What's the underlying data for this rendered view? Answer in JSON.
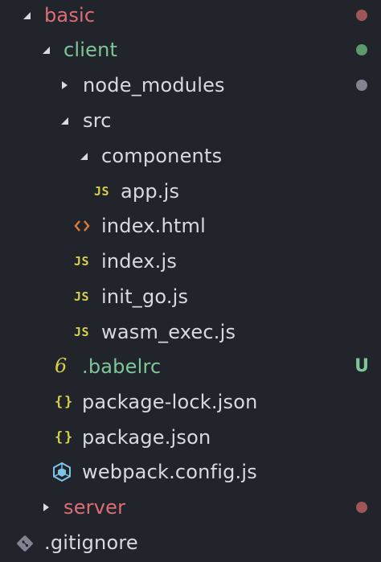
{
  "colors": {
    "background": "#21252b",
    "twisty": "#d7dae0",
    "text_default": "#d7dae0",
    "text_modified": "#e06c75",
    "text_untracked": "#7ec699",
    "dot_modified": "#a05559",
    "dot_untracked": "#5d9a6a",
    "dot_ignored": "#7f848e",
    "js_icon": "#d6cf4b",
    "json_icon": "#d6cf4b",
    "html_icon": "#e07b39",
    "babel_icon": "#d6cf4b",
    "webpack_icon": "#7ec3e6",
    "git_icon": "#7f848e"
  },
  "tree": [
    {
      "name": "basic",
      "kind": "folder",
      "expanded": true,
      "status": "modified",
      "badge": "dot"
    },
    {
      "name": "client",
      "kind": "folder",
      "expanded": true,
      "status": "untracked",
      "badge": "dot"
    },
    {
      "name": "node_modules",
      "kind": "folder",
      "expanded": false,
      "status": "ignored",
      "badge": "dot"
    },
    {
      "name": "src",
      "kind": "folder",
      "expanded": true,
      "status": "default",
      "badge": ""
    },
    {
      "name": "components",
      "kind": "folder",
      "expanded": true,
      "status": "default",
      "badge": ""
    },
    {
      "name": "app.js",
      "kind": "file",
      "icon": "javascript-icon",
      "icon_text": "JS",
      "status": "default",
      "badge": ""
    },
    {
      "name": "index.html",
      "kind": "file",
      "icon": "html-icon",
      "icon_text": "<>",
      "status": "default",
      "badge": ""
    },
    {
      "name": "index.js",
      "kind": "file",
      "icon": "javascript-icon",
      "icon_text": "JS",
      "status": "default",
      "badge": ""
    },
    {
      "name": "init_go.js",
      "kind": "file",
      "icon": "javascript-icon",
      "icon_text": "JS",
      "status": "default",
      "badge": ""
    },
    {
      "name": "wasm_exec.js",
      "kind": "file",
      "icon": "javascript-icon",
      "icon_text": "JS",
      "status": "default",
      "badge": ""
    },
    {
      "name": ".babelrc",
      "kind": "file",
      "icon": "babel-icon",
      "icon_text": "6",
      "status": "untracked",
      "badge": "U"
    },
    {
      "name": "package-lock.json",
      "kind": "file",
      "icon": "json-icon",
      "icon_text": "{}",
      "status": "default",
      "badge": ""
    },
    {
      "name": "package.json",
      "kind": "file",
      "icon": "json-icon",
      "icon_text": "{}",
      "status": "default",
      "badge": ""
    },
    {
      "name": "webpack.config.js",
      "kind": "file",
      "icon": "webpack-icon",
      "icon_text": "",
      "status": "default",
      "badge": ""
    },
    {
      "name": "server",
      "kind": "folder",
      "expanded": false,
      "status": "modified",
      "badge": "dot"
    },
    {
      "name": ".gitignore",
      "kind": "file",
      "icon": "git-icon",
      "icon_text": "",
      "status": "default",
      "badge": ""
    }
  ]
}
